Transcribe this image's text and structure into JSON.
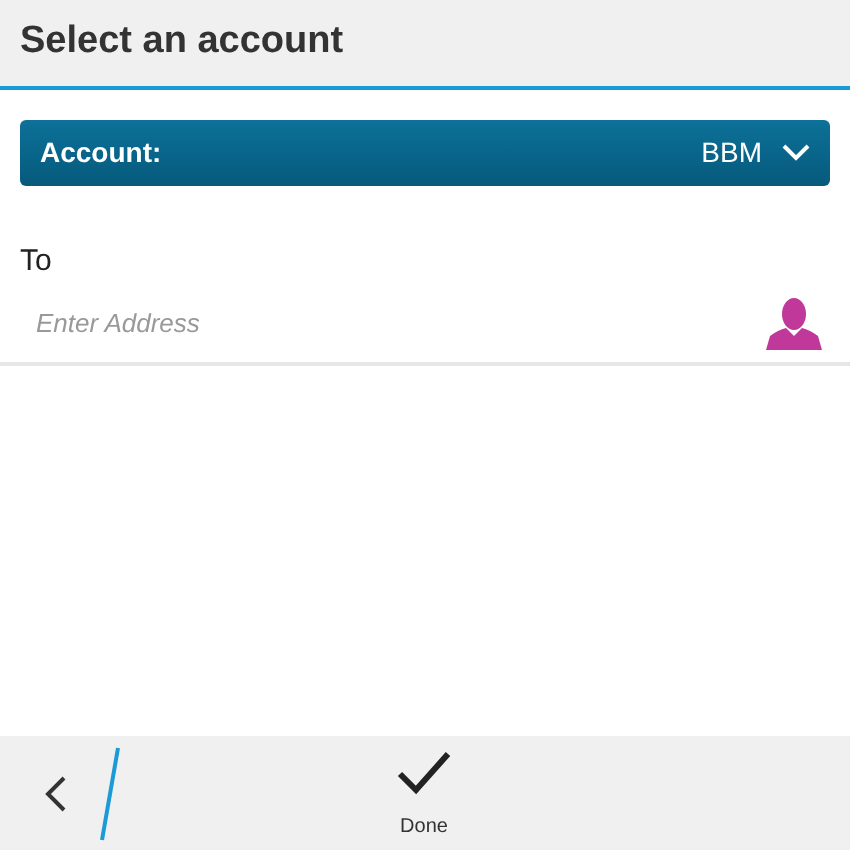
{
  "title_bar": {
    "title": "Select an account"
  },
  "account_dropdown": {
    "label": "Account:",
    "value": "BBM"
  },
  "to_field": {
    "label": "To",
    "placeholder": "Enter Address"
  },
  "action_bar": {
    "done_label": "Done"
  }
}
